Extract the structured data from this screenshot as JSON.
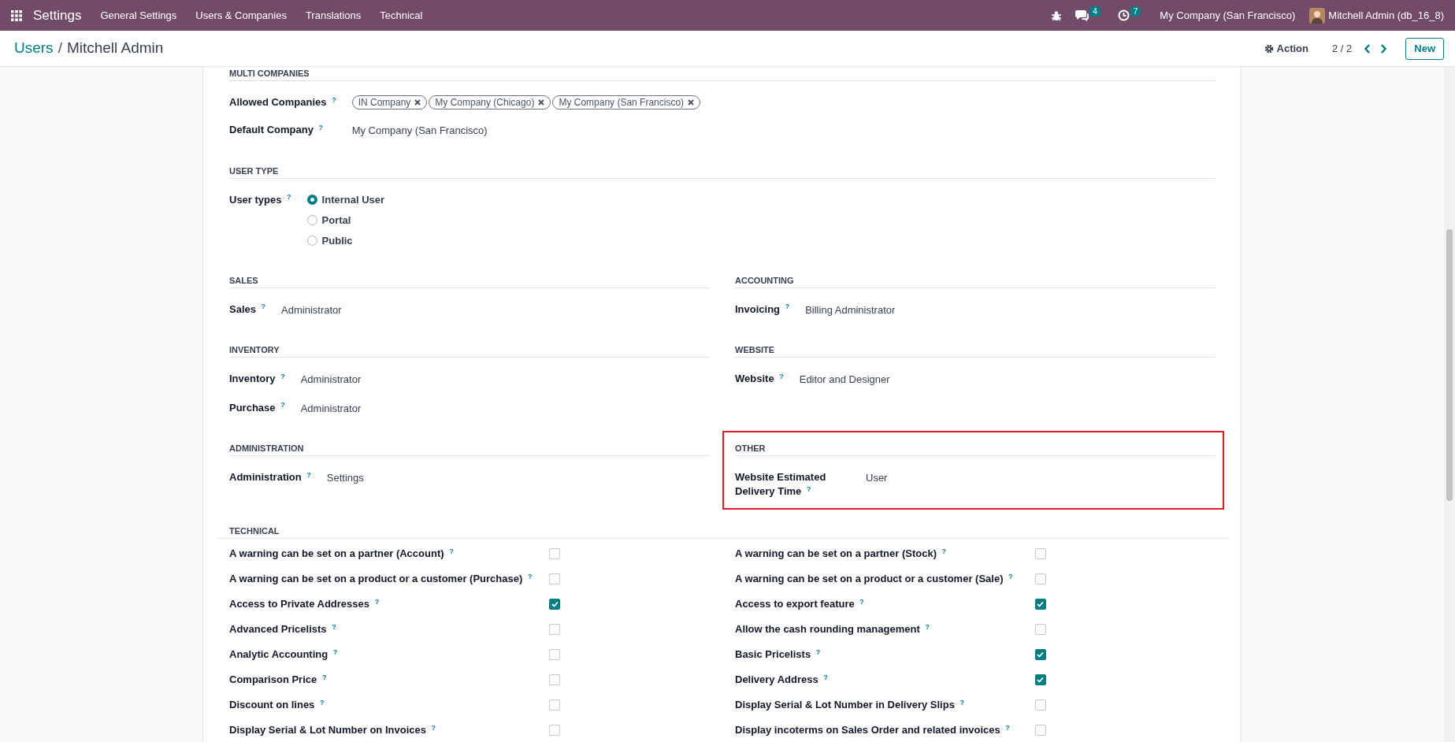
{
  "navbar": {
    "app_name": "Settings",
    "menu": [
      "General Settings",
      "Users & Companies",
      "Translations",
      "Technical"
    ],
    "messages_count": "4",
    "activities_count": "7",
    "company": "My Company (San Francisco)",
    "user": "Mitchell Admin (db_16_8)"
  },
  "control_panel": {
    "breadcrumb": [
      "Users",
      "Mitchell Admin"
    ],
    "breadcrumb_separator": "/",
    "action": "Action",
    "pager": "2 / 2",
    "new_button": "New"
  },
  "section_rows": [
    {
      "sections": [
        {
          "title": "MULTI COMPANIES",
          "fields": [
            {
              "kind": "tags",
              "label": "Allowed Companies $^{?}$",
              "tags": [
                "IN Company",
                "My Company (Chicago)",
                "My Company (San Francisco)"
              ]
            },
            {
              "kind": "text",
              "label": "Default Company $^{?}$",
              "value": "My Company (San Francisco)"
            }
          ]
        }
      ]
    },
    {
      "sections": [
        {
          "title": "USER TYPE",
          "fields": [
            {
              "kind": "radio",
              "label": "User types $^{?}$",
              "options": [
                {
                  "label": "Internal User",
                  "selected": true
                },
                {
                  "label": "Portal",
                  "selected": false
                },
                {
                  "label": "Public",
                  "selected": false
                }
              ]
            }
          ]
        }
      ]
    },
    {
      "sections": [
        {
          "title": "SALES",
          "fields": [
            {
              "kind": "text",
              "label": "Sales $^{?}$",
              "value": "Administrator"
            }
          ]
        },
        {
          "title": "ACCOUNTING",
          "fields": [
            {
              "kind": "text",
              "label": "Invoicing $^{?}$",
              "value": "Billing Administrator"
            }
          ]
        }
      ]
    },
    {
      "sections": [
        {
          "title": "INVENTORY",
          "fields": [
            {
              "kind": "text",
              "label": "Inventory $^{?}$",
              "value": "Administrator"
            },
            {
              "kind": "text",
              "label": "Purchase $^{?}$",
              "value": "Administrator"
            }
          ]
        },
        {
          "title": "WEBSITE",
          "fields": [
            {
              "kind": "text",
              "label": "Website $^{?}$",
              "value": "Editor and Designer"
            }
          ]
        }
      ]
    },
    {
      "sections": [
        {
          "title": "ADMINISTRATION",
          "fields": [
            {
              "kind": "text",
              "label": "Administration $^{?}$",
              "value": "Settings"
            }
          ]
        },
        {
          "title": "OTHER",
          "highlighted": true,
          "fields": [
            {
              "kind": "text",
              "label": "Website Estimated Delivery Time $^{?}$",
              "value": "User"
            }
          ]
        }
      ]
    }
  ],
  "technical": {
    "title": "TECHNICAL",
    "options": [
      {
        "label": "A warning can be set on a partner (Account) $^{?}$",
        "checked": false
      },
      {
        "label": "A warning can be set on a partner (Stock) $^{?}$",
        "checked": false
      },
      {
        "label": "A warning can be set on a product or a customer (Purchase) $^{?}$",
        "checked": false
      },
      {
        "label": "A warning can be set on a product or a customer (Sale) $^{?}$",
        "checked": false
      },
      {
        "label": "Access to Private Addresses $^{?}$",
        "checked": true
      },
      {
        "label": "Access to export feature $^{?}$",
        "checked": true
      },
      {
        "label": "Advanced Pricelists $^{?}$",
        "checked": false
      },
      {
        "label": "Allow the cash rounding management $^{?}$",
        "checked": false
      },
      {
        "label": "Analytic Accounting $^{?}$",
        "checked": false
      },
      {
        "label": "Basic Pricelists $^{?}$",
        "checked": true
      },
      {
        "label": "Comparison Price $^{?}$",
        "checked": false
      },
      {
        "label": "Delivery Address $^{?}$",
        "checked": true
      },
      {
        "label": "Discount on lines $^{?}$",
        "checked": false
      },
      {
        "label": "Display Serial & Lot Number in Delivery Slips $^{?}$",
        "checked": false
      },
      {
        "label": "Display Serial & Lot Number on Invoices $^{?}$",
        "checked": false
      },
      {
        "label": "Display incoterms on Sales Order and related invoices $^{?}$",
        "checked": false
      }
    ]
  }
}
